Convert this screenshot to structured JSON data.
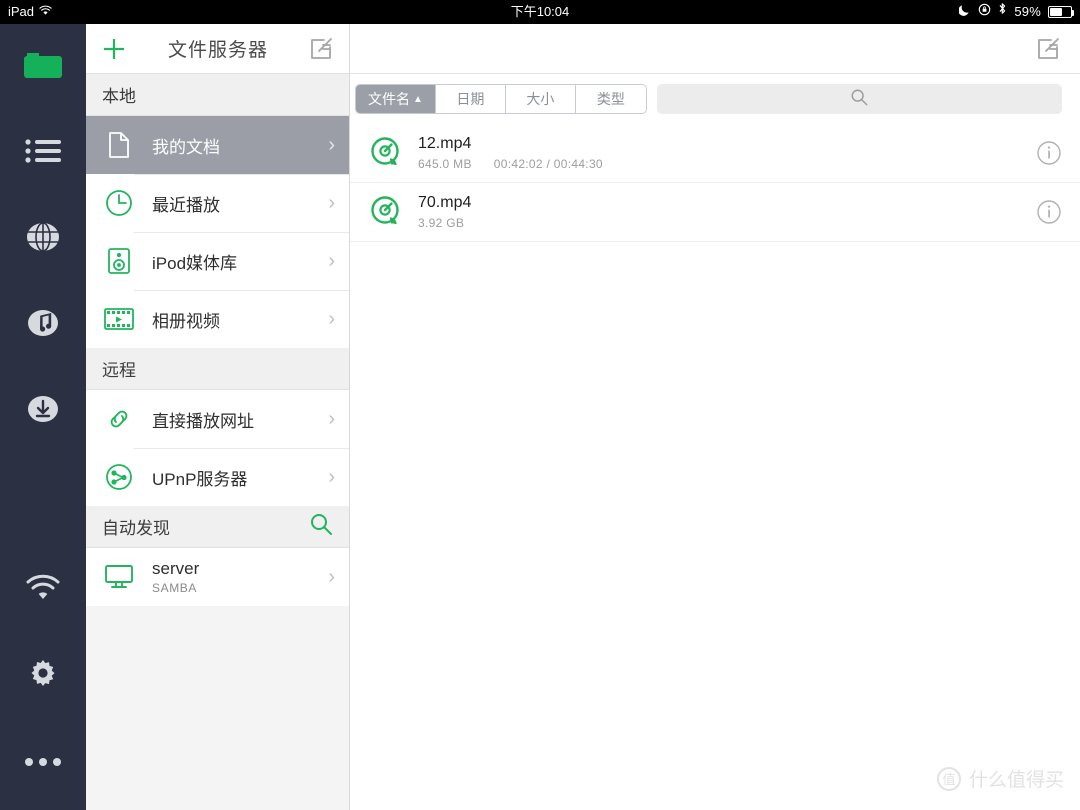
{
  "statusbar": {
    "device": "iPad",
    "wifi_icon": "wifi-icon",
    "time": "下午10:04",
    "moon_icon": "do-not-disturb-moon-icon",
    "rotation_lock_icon": "rotation-lock-icon",
    "bluetooth_icon": "bluetooth-icon",
    "battery_percent": "59%"
  },
  "rail": {
    "background": "#2b3142",
    "accent": "#15b05a",
    "items": [
      {
        "name": "folder-icon",
        "label": "文件",
        "active": true
      },
      {
        "name": "list-icon",
        "label": "列表",
        "active": false
      },
      {
        "name": "globe-icon",
        "label": "网络",
        "active": false
      },
      {
        "name": "music-icon",
        "label": "音乐",
        "active": false
      },
      {
        "name": "download-icon",
        "label": "下载",
        "active": false
      }
    ],
    "bottom_items": [
      {
        "name": "wifi-icon",
        "label": "Wi-Fi"
      },
      {
        "name": "gear-icon",
        "label": "设置"
      },
      {
        "name": "more-icon",
        "label": "更多"
      }
    ]
  },
  "nav": {
    "add_label": "+",
    "title": "文件服务器",
    "edit_icon": "edit-compose-icon",
    "sections": [
      {
        "title": "本地",
        "action_icon": null,
        "items": [
          {
            "icon": "document-icon",
            "label": "我的文档",
            "sub": null,
            "selected": true
          },
          {
            "icon": "clock-icon",
            "label": "最近播放",
            "sub": null,
            "selected": false
          },
          {
            "icon": "speaker-icon",
            "label": "iPod媒体库",
            "sub": null,
            "selected": false
          },
          {
            "icon": "film-icon",
            "label": "相册视频",
            "sub": null,
            "selected": false
          }
        ]
      },
      {
        "title": "远程",
        "action_icon": null,
        "items": [
          {
            "icon": "link-icon",
            "label": "直接播放网址",
            "sub": null,
            "selected": false
          },
          {
            "icon": "upnp-network-icon",
            "label": "UPnP服务器",
            "sub": null,
            "selected": false
          }
        ]
      },
      {
        "title": "自动发现",
        "action_icon": "search-icon",
        "items": [
          {
            "icon": "monitor-icon",
            "label": "server",
            "sub": "SAMBA",
            "selected": false
          }
        ]
      }
    ]
  },
  "content": {
    "edit_icon": "edit-compose-icon",
    "sort_tabs": [
      {
        "label": "文件名",
        "caret": "▲",
        "active": true
      },
      {
        "label": "日期",
        "caret": "",
        "active": false
      },
      {
        "label": "大小",
        "caret": "",
        "active": false
      },
      {
        "label": "类型",
        "caret": "",
        "active": false
      }
    ],
    "search": {
      "placeholder": "",
      "value": "",
      "icon": "search-icon"
    },
    "files": [
      {
        "icon": "media-player-icon",
        "name": "12.mp4",
        "size": "645.0 MB",
        "progress": "00:42:02 / 00:44:30",
        "info_icon": "info-icon"
      },
      {
        "icon": "media-player-icon",
        "name": "70.mp4",
        "size": "3.92 GB",
        "progress": "",
        "info_icon": "info-icon"
      }
    ]
  },
  "watermark": {
    "badge": "值",
    "text": "什么值得买"
  }
}
